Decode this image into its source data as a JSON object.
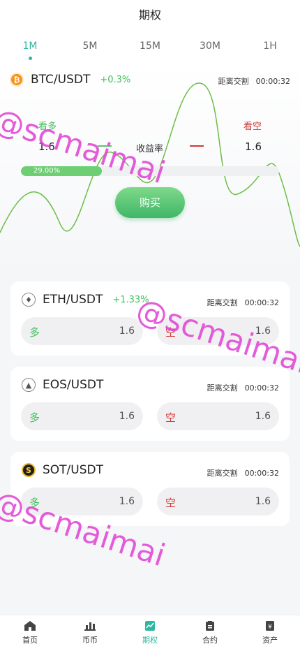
{
  "header": {
    "title": "期权"
  },
  "tabs": [
    {
      "label": "1M",
      "active": true
    },
    {
      "label": "5M"
    },
    {
      "label": "15M"
    },
    {
      "label": "30M"
    },
    {
      "label": "1H"
    }
  ],
  "hero": {
    "pair": "BTC/USDT",
    "change": "+0.3%",
    "countdown_label": "距离交割",
    "countdown": "00:00:32",
    "long_label": "看多",
    "short_label": "看空",
    "long_value": "1.6",
    "short_value": "1.6",
    "rate_label": "收益率",
    "progress_text": "29.00%",
    "progress_fraction": 0.29,
    "buy_label": "购买"
  },
  "cards": [
    {
      "pair": "ETH/USDT",
      "change": "+1.33%",
      "countdown_label": "距离交割",
      "countdown": "00:00:32",
      "long_label": "多",
      "long_value": "1.6",
      "short_label": "空",
      "short_value": "1.6"
    },
    {
      "pair": "EOS/USDT",
      "change": "",
      "countdown_label": "距离交割",
      "countdown": "00:00:32",
      "long_label": "多",
      "long_value": "1.6",
      "short_label": "空",
      "short_value": "1.6"
    },
    {
      "pair": "SOT/USDT",
      "change": "",
      "countdown_label": "距离交割",
      "countdown": "00:00:32",
      "long_label": "多",
      "long_value": "1.6",
      "short_label": "空",
      "short_value": "1.6"
    }
  ],
  "watermark": "@scmaimai",
  "bottom_nav": [
    {
      "label": "首页",
      "icon": "home-icon"
    },
    {
      "label": "币币",
      "icon": "bar-chart-icon"
    },
    {
      "label": "期权",
      "icon": "options-icon",
      "active": true
    },
    {
      "label": "合约",
      "icon": "clipboard-icon"
    },
    {
      "label": "资产",
      "icon": "wallet-icon"
    }
  ],
  "colors": {
    "accent": "#2db8a1",
    "up": "#3fbf5a",
    "down": "#d03838",
    "watermark": "#e040d4"
  }
}
